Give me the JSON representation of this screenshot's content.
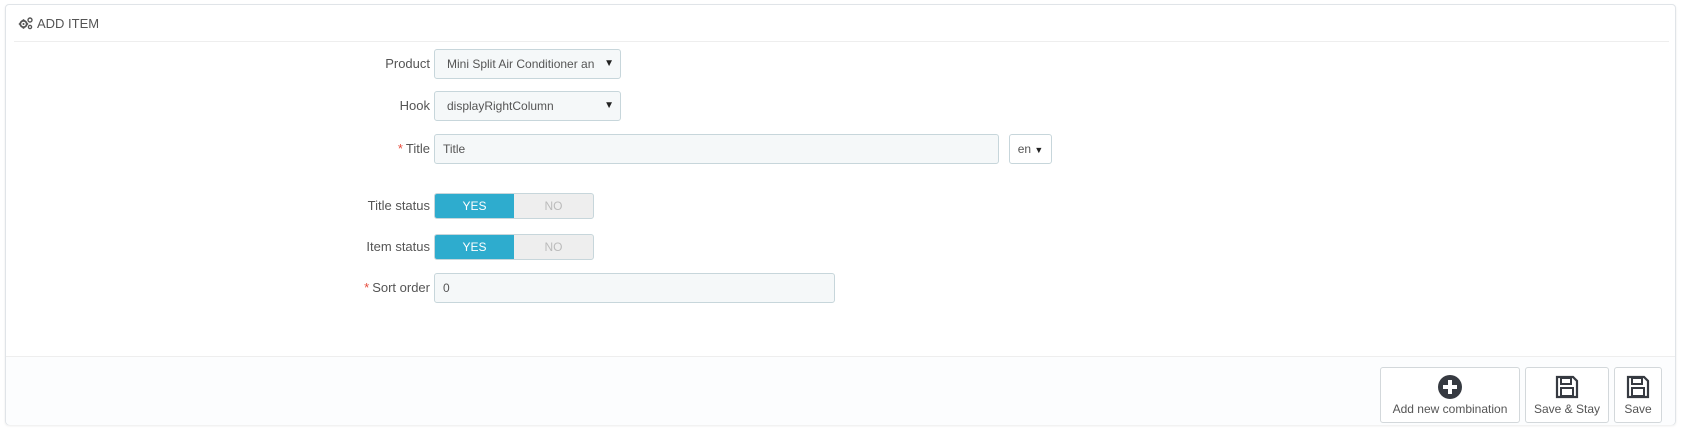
{
  "header": {
    "title": "ADD ITEM",
    "icon": "cogs-icon"
  },
  "form": {
    "product": {
      "label": "Product",
      "value": "Mini Split Air Conditioner an"
    },
    "hook": {
      "label": "Hook",
      "value": "displayRightColumn"
    },
    "title": {
      "label": "Title",
      "required_mark": "*",
      "value": "Title",
      "language": "en"
    },
    "title_status": {
      "label": "Title status",
      "yes": "YES",
      "no": "NO",
      "selected": "YES"
    },
    "item_status": {
      "label": "Item status",
      "yes": "YES",
      "no": "NO",
      "selected": "YES"
    },
    "sort_order": {
      "label": "Sort order",
      "required_mark": "*",
      "value": "0"
    }
  },
  "footer": {
    "add_combination_label": "Add new combination",
    "save_stay_label": "Save & Stay",
    "save_label": "Save"
  },
  "colors": {
    "accent": "#2eacce",
    "required": "#e74c3c",
    "input_bg": "#f5f8f9",
    "input_border": "#c7d6db"
  }
}
